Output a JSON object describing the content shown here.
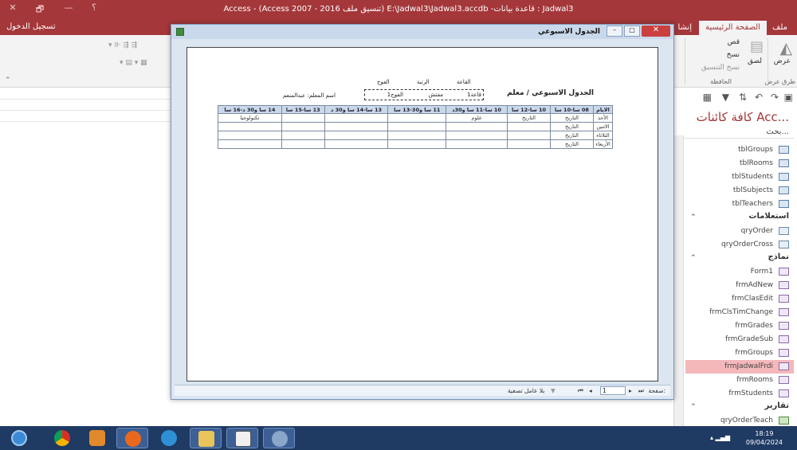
{
  "app": {
    "title": "Access - (Access 2007 - 2016 تنسيق ملف) E:\\Jadwal3\\Jadwal3.accdb -قاعدة بيانات : Jadwal3",
    "signin": "تسجيل الدخول",
    "help": "؟",
    "minimize": "—",
    "restore": "🗗",
    "close": "✕"
  },
  "ribbon_tabs": [
    {
      "label": "ملف"
    },
    {
      "label": "الصفحة الرئيسية"
    },
    {
      "label": "إنشا"
    }
  ],
  "ribbon": {
    "view_label": "عرض",
    "view_group": "طرق عرض",
    "paste_label": "لصق",
    "cut_label": "قص",
    "copy_label": "نسخ",
    "format_painter_label": "نسخ التنسيق",
    "clipboard_group": "الحافظة"
  },
  "nav": {
    "title": "كافة كائنات Acc...",
    "search": "بحث...",
    "tables": [
      {
        "label": "tblGroups"
      },
      {
        "label": "tblRooms"
      },
      {
        "label": "tblStudents"
      },
      {
        "label": "tblSubjects"
      },
      {
        "label": "tblTeachers"
      }
    ],
    "queries_group": "استعلامات",
    "queries": [
      {
        "label": "qryOrder"
      },
      {
        "label": "qryOrderCross"
      }
    ],
    "forms_group": "نماذج",
    "forms": [
      {
        "label": "Form1"
      },
      {
        "label": "frmAdNew"
      },
      {
        "label": "frmClasEdit"
      },
      {
        "label": "frmClsTimChange"
      },
      {
        "label": "frmGrades"
      },
      {
        "label": "frmGradeSub"
      },
      {
        "label": "frmGroups"
      },
      {
        "label": "frmJadwalFrdi"
      },
      {
        "label": "frmRooms"
      },
      {
        "label": "frmStudents"
      }
    ],
    "reports_group": "تقارير",
    "reports": [
      {
        "label": "qryOrderTeach"
      }
    ]
  },
  "report": {
    "window_title": "الجدول الاسبوعي",
    "report_title": "الجدول الاسبوعي / معلم",
    "teacher_label": "اسم المعلم: عبدالمنعم",
    "hdr_room": "القاعة",
    "hdr_rank": "الرتبة",
    "hdr_group": "الفوج",
    "val_room": "قاعة1",
    "val_rank": "مفتش",
    "val_group": "الفوج1",
    "columns": [
      "الايام",
      "08 سا-10 سا",
      "10 سا-12 سا",
      "10 سا-11 سا و30د",
      "11 سا و30-13 سا",
      "13 سا-14 سا و30 د",
      "13 سا-15 سا",
      "14 سا و30 د-16 سا"
    ],
    "rows": [
      [
        "الأحد",
        "التاريخ",
        "التاريخ",
        "علوم",
        "",
        "",
        "",
        "تكنولوجيا"
      ],
      [
        "الاثنين",
        "التاريخ",
        "",
        "",
        "",
        "",
        "",
        ""
      ],
      [
        "الثلاثاء",
        "التاريخ",
        "",
        "",
        "",
        "",
        "",
        ""
      ],
      [
        "الأربعاء",
        "التاريخ",
        "",
        "",
        "",
        "",
        "",
        ""
      ]
    ],
    "page_label": "صفحة:",
    "page_value": "1",
    "filter_label": "بلا عامل تصفية"
  },
  "taskbar": {
    "time": "18:19",
    "date": "09/04/2024"
  }
}
